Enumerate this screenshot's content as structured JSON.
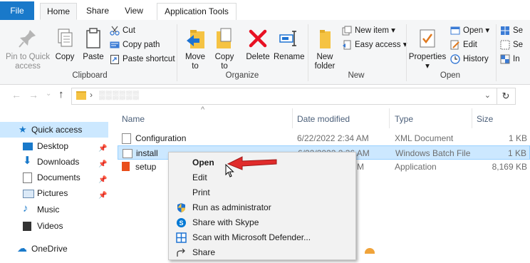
{
  "tabs": {
    "file": "File",
    "home": "Home",
    "share": "Share",
    "view": "View",
    "app_tools": "Application Tools",
    "extra_left": "Se",
    "extra_left2": "Se",
    "extra_left3": "In"
  },
  "ribbon": {
    "clipboard": {
      "pin": "Pin to Quick access",
      "copy": "Copy",
      "paste": "Paste",
      "cut": "Cut",
      "copy_path": "Copy path",
      "paste_shortcut": "Paste shortcut",
      "label": "Clipboard"
    },
    "organize": {
      "move_to": "Move to",
      "copy_to": "Copy to",
      "delete": "Delete",
      "rename": "Rename",
      "label": "Organize"
    },
    "new": {
      "new_folder": "New folder",
      "new_item": "New item",
      "easy_access": "Easy access",
      "label": "New"
    },
    "open": {
      "properties": "Properties",
      "open": "Open",
      "edit": "Edit",
      "history": "History",
      "label": "Open"
    }
  },
  "address": {
    "path_blurred": "▒▒▒▒▒▒"
  },
  "columns": {
    "name": "Name",
    "date": "Date modified",
    "type": "Type",
    "size": "Size"
  },
  "nav": [
    {
      "label": "Quick access",
      "pinned": false
    },
    {
      "label": "Desktop",
      "pinned": true
    },
    {
      "label": "Downloads",
      "pinned": true
    },
    {
      "label": "Documents",
      "pinned": true
    },
    {
      "label": "Pictures",
      "pinned": true
    },
    {
      "label": "Music",
      "pinned": false
    },
    {
      "label": "Videos",
      "pinned": false
    },
    {
      "label": "OneDrive",
      "pinned": false
    }
  ],
  "files": [
    {
      "name": "Configuration",
      "date": "6/22/2022 2:34 AM",
      "type": "XML Document",
      "size": "1 KB"
    },
    {
      "name": "install",
      "date": "6/22/2022 2:36 AM",
      "type": "Windows Batch File",
      "size": "1 KB"
    },
    {
      "name": "setup",
      "date": "M",
      "type": "Application",
      "size": "8,169 KB"
    }
  ],
  "context_menu": [
    "Open",
    "Edit",
    "Print",
    "Run as administrator",
    "Share with Skype",
    "Scan with Microsoft Defender...",
    "Share"
  ],
  "colors": {
    "accent": "#1979ca",
    "selection": "#cce8ff",
    "arrow": "#e02b2b",
    "folder": "#f5c343",
    "delete": "#e81123"
  }
}
